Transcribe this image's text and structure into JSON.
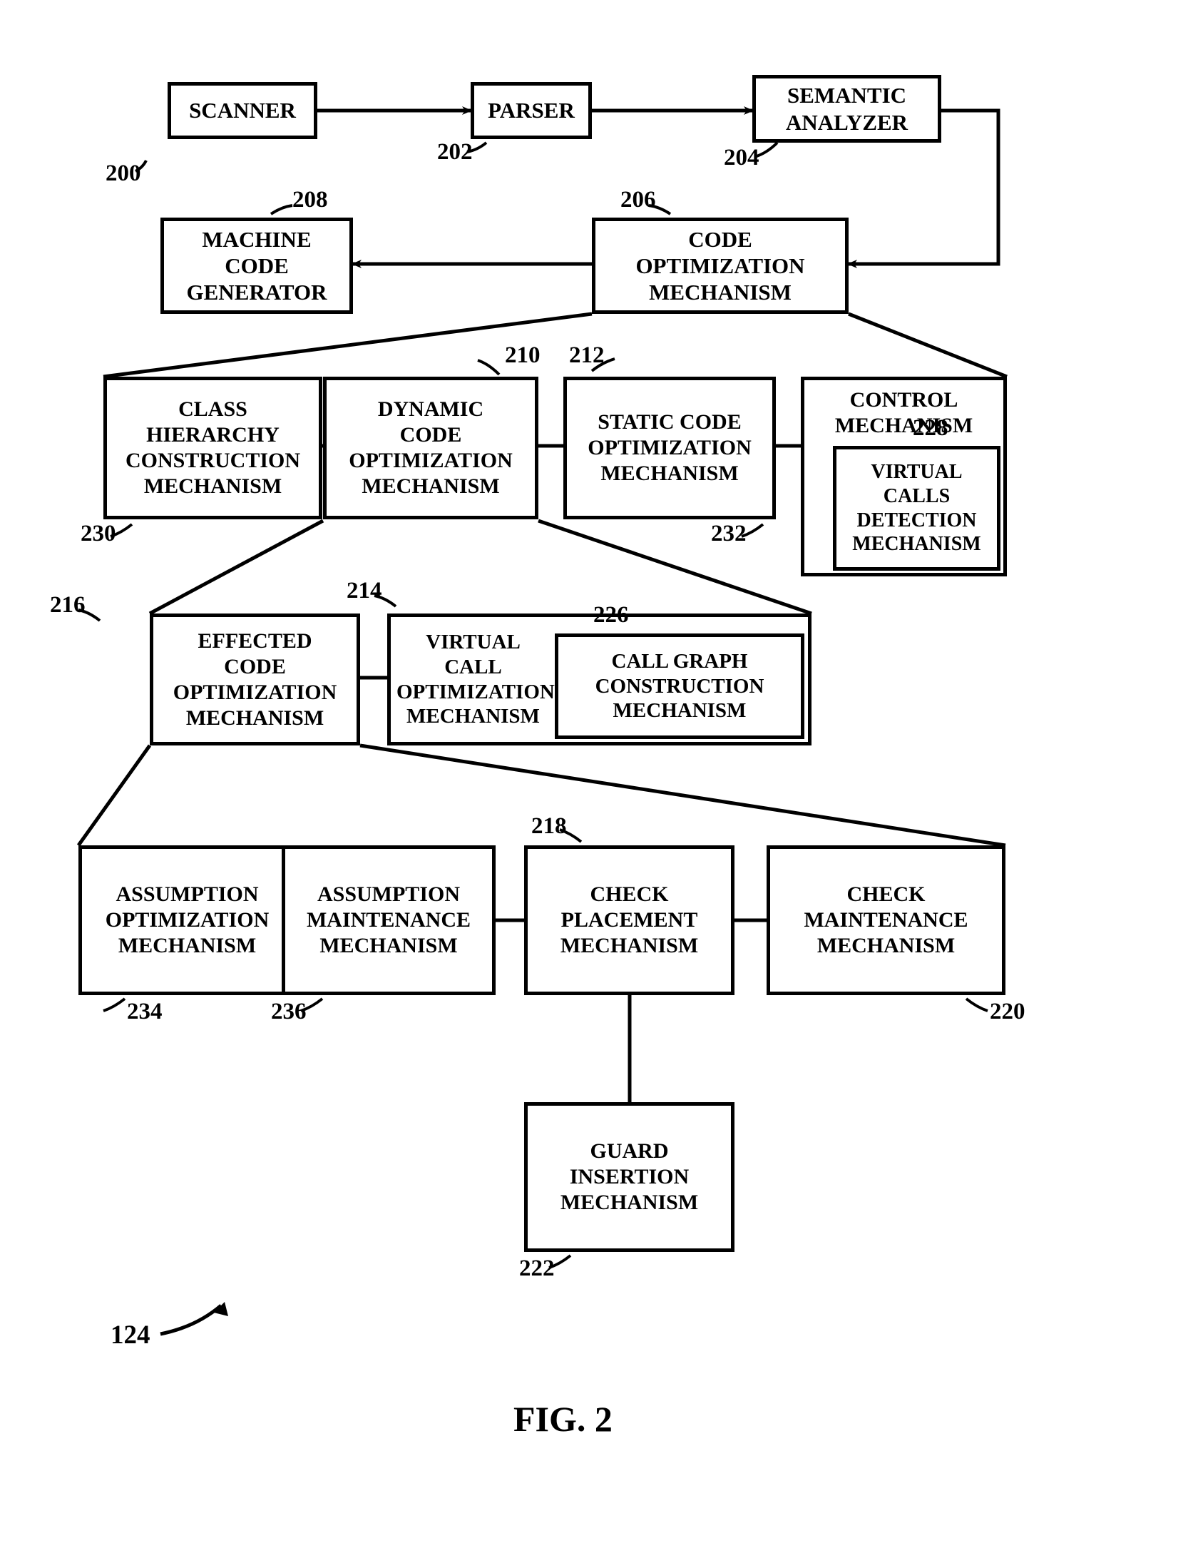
{
  "boxes": {
    "scanner": "SCANNER",
    "parser": "PARSER",
    "semantic": "SEMANTIC<br>ANALYZER",
    "machine_code": "MACHINE<br>CODE<br>GENERATOR",
    "code_opt": "CODE<br>OPTIMIZATION<br>MECHANISM",
    "class_hier": "CLASS<br>HIERARCHY<br>CONSTRUCTION<br>MECHANISM",
    "dynamic": "DYNAMIC<br>CODE<br>OPTIMIZATION<br>MECHANISM",
    "static": "STATIC CODE<br>OPTIMIZATION<br>MECHANISM",
    "control": "CONTROL<br>MECHANISM",
    "virtual_calls_det": "VIRTUAL<br>CALLS<br>DETECTION<br>MECHANISM",
    "effected": "EFFECTED<br>CODE<br>OPTIMIZATION<br>MECHANISM",
    "virtual_call_opt": "VIRTUAL CALL<br>OPTIMIZATION<br>MECHANISM",
    "call_graph": "CALL GRAPH<br>CONSTRUCTION<br>MECHANISM",
    "assump_opt": "ASSUMPTION<br>OPTIMIZATION<br>MECHANISM",
    "assump_maint": "ASSUMPTION<br>MAINTENANCE<br>MECHANISM",
    "check_place": "CHECK<br>PLACEMENT<br>MECHANISM",
    "check_maint": "CHECK<br>MAINTENANCE<br>MECHANISM",
    "guard": "GUARD<br>INSERTION<br>MECHANISM"
  },
  "labels": {
    "l200": "200",
    "l202": "202",
    "l204": "204",
    "l206": "206",
    "l208": "208",
    "l210": "210",
    "l212": "212",
    "l214": "214",
    "l216": "216",
    "l218": "218",
    "l220": "220",
    "l222": "222",
    "l226": "226",
    "l228": "228",
    "l230": "230",
    "l232": "232",
    "l234": "234",
    "l236": "236",
    "l124": "124"
  },
  "caption": "FIG. 2"
}
